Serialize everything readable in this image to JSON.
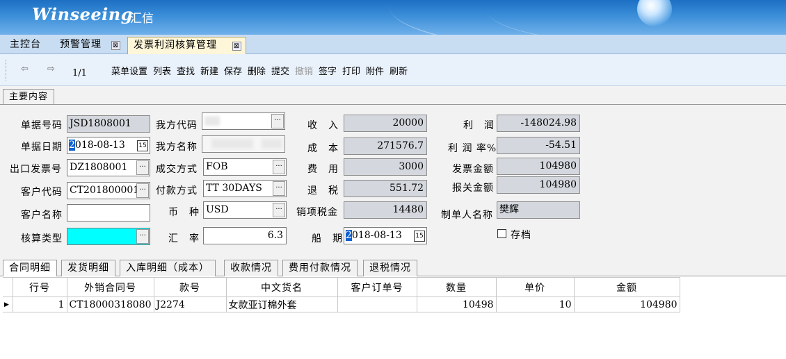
{
  "banner": {
    "logo": "Winseeing",
    "logo_cn": "汇信"
  },
  "tabs": [
    {
      "label": "主控台"
    },
    {
      "label": "预警管理",
      "close": "⊠"
    },
    {
      "label": "发票利润核算管理",
      "close": "⊠"
    }
  ],
  "toolbar": {
    "page": "1/1",
    "buttons": [
      "菜单设置",
      "列表",
      "查找",
      "新建",
      "保存",
      "删除",
      "提交",
      "撤销",
      "签字",
      "打印",
      "附件",
      "刷新"
    ]
  },
  "main_tab": "主要内容",
  "form": {
    "labels": {
      "doc_no": "单据号码",
      "our_code": "我方代码",
      "income": "收　入",
      "profit": "利　润",
      "doc_date": "单据日期",
      "our_name": "我方名称",
      "cost": "成　本",
      "profit_rate": "利 润 率%",
      "export_invoice": "出口发票号",
      "deal_method": "成交方式",
      "expense": "费　用",
      "invoice_amount": "发票金额",
      "customer_code": "客户代码",
      "payment_method": "付款方式",
      "tax_refund": "退　税",
      "customs_amount": "报关金额",
      "customer_name": "客户名称",
      "currency": "币　种",
      "output_tax": "销项税金",
      "creator_name": "制单人名称",
      "calc_type": "核算类型",
      "exchange_rate": "汇　率",
      "ship_date": "船　期",
      "archive": "存档"
    },
    "values": {
      "doc_no": "JSD1808001",
      "doc_date_first": "2",
      "doc_date_rest": "018-08-13",
      "export_invoice": "DZ1808001",
      "customer_code": "CT201800001",
      "customer_name": "",
      "calc_type": "",
      "our_code": "",
      "our_name": "",
      "deal_method": "FOB",
      "payment_method": "TT 30DAYS",
      "currency": "USD",
      "exchange_rate": "6.3",
      "income": "20000",
      "cost": "271576.7",
      "expense": "3000",
      "tax_refund": "551.72",
      "output_tax": "14480",
      "ship_date_first": "2",
      "ship_date_rest": "018-08-13",
      "profit": "-148024.98",
      "profit_rate": "-54.51",
      "invoice_amount": "104980",
      "customs_amount": "104980",
      "creator_name": "樊辉"
    }
  },
  "subtabs": [
    "合同明细",
    "发货明细",
    "入库明细（成本）",
    "收款情况",
    "费用付款情况",
    "退税情况"
  ],
  "grid": {
    "columns": [
      "行号",
      "外销合同号",
      "款号",
      "中文货名",
      "客户订单号",
      "数量",
      "单价",
      "金额"
    ],
    "rows": [
      {
        "line": "1",
        "contract": "CT18000318080",
        "style": "J2274",
        "name": "女款亚订棉外套",
        "po": "",
        "qty": "10498",
        "price": "10",
        "amount": "104980"
      }
    ]
  }
}
